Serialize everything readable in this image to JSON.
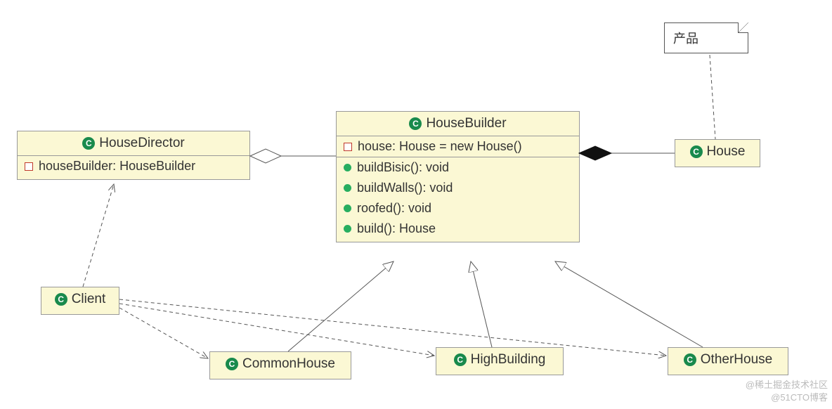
{
  "note": {
    "label": "产品"
  },
  "classes": {
    "houseDirector": {
      "name": "HouseDirector",
      "fields": [
        {
          "vis": "prot",
          "sig": "houseBuilder: HouseBuilder"
        }
      ]
    },
    "houseBuilder": {
      "name": "HouseBuilder",
      "fields": [
        {
          "vis": "prot",
          "sig": "house: House = new House()"
        }
      ],
      "methods": [
        {
          "vis": "pub",
          "sig": "buildBisic(): void"
        },
        {
          "vis": "pub",
          "sig": "buildWalls(): void"
        },
        {
          "vis": "pub",
          "sig": "roofed(): void"
        },
        {
          "vis": "pub",
          "sig": "build(): House"
        }
      ]
    },
    "house": {
      "name": "House"
    },
    "client": {
      "name": "Client"
    },
    "commonHouse": {
      "name": "CommonHouse"
    },
    "highBuilding": {
      "name": "HighBuilding"
    },
    "otherHouse": {
      "name": "OtherHouse"
    }
  },
  "watermarks": {
    "top": "@稀土掘金技术社区",
    "bottom": "@51CTO博客"
  },
  "relations": [
    {
      "from": "HouseDirector",
      "to": "HouseBuilder",
      "kind": "aggregation"
    },
    {
      "from": "HouseBuilder",
      "to": "House",
      "kind": "composition"
    },
    {
      "from": "产品 (note)",
      "to": "House",
      "kind": "note-anchor"
    },
    {
      "from": "Client",
      "to": "HouseDirector",
      "kind": "dependency"
    },
    {
      "from": "Client",
      "to": "CommonHouse",
      "kind": "dependency"
    },
    {
      "from": "Client",
      "to": "HighBuilding",
      "kind": "dependency"
    },
    {
      "from": "Client",
      "to": "OtherHouse",
      "kind": "dependency"
    },
    {
      "from": "CommonHouse",
      "to": "HouseBuilder",
      "kind": "generalization"
    },
    {
      "from": "HighBuilding",
      "to": "HouseBuilder",
      "kind": "generalization"
    },
    {
      "from": "OtherHouse",
      "to": "HouseBuilder",
      "kind": "generalization"
    }
  ]
}
